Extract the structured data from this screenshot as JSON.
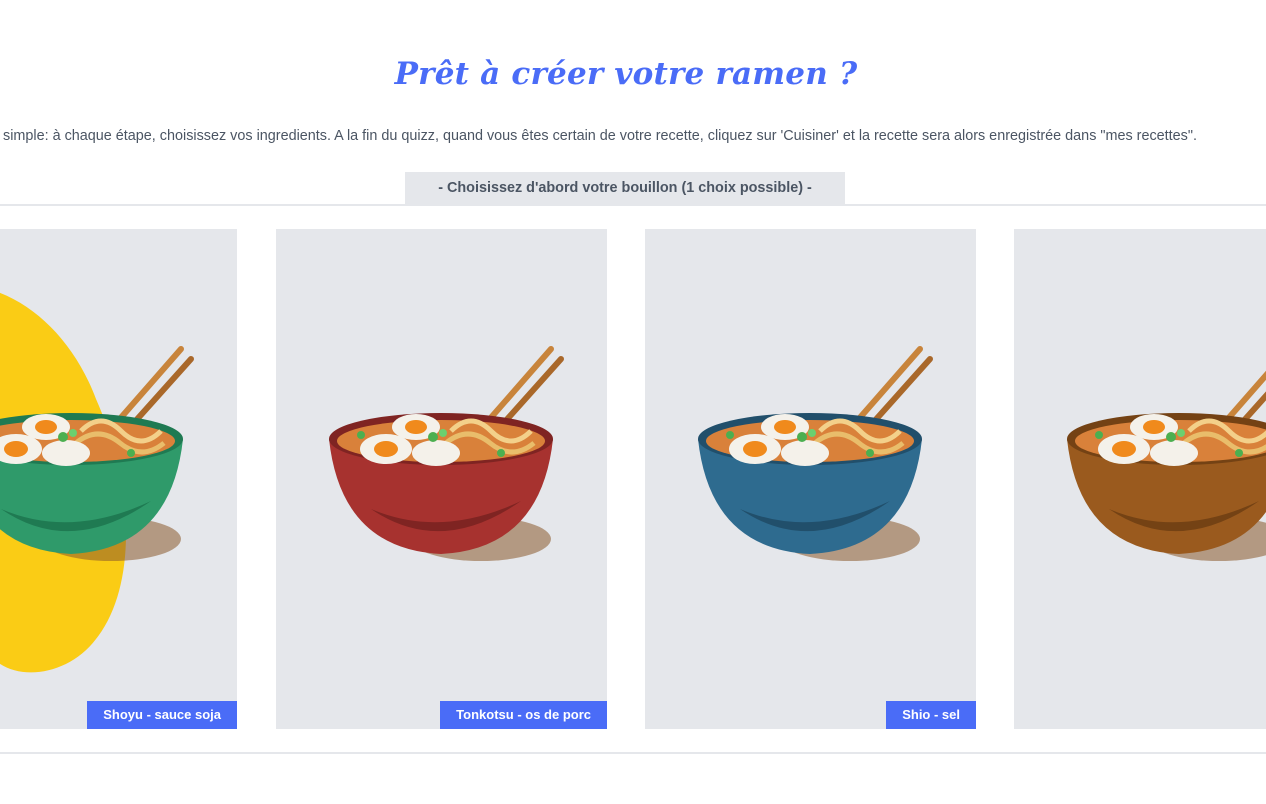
{
  "header": {
    "title": "Prêt à créer votre ramen ?",
    "intro": "simple: à chaque étape, choisissez vos ingredients. A la fin du quizz, quand vous êtes certain de votre recette, cliquez sur 'Cuisiner' et la recette sera alors enregistrée dans \"mes recettes\"."
  },
  "step": {
    "label": "- Choisissez d'abord votre bouillon (1 choix possible) -"
  },
  "colors": {
    "accent": "#4a6cf7",
    "card_bg": "#e5e7eb",
    "selected_blob": "#facc15"
  },
  "options": [
    {
      "label": "Shoyu - sauce soja",
      "bowl_color": "#2f9a6a",
      "bowl_shade": "#1f7a52",
      "selected": true,
      "icon": "ramen-bowl-icon"
    },
    {
      "label": "Tonkotsu - os de porc",
      "bowl_color": "#a7322f",
      "bowl_shade": "#7f2422",
      "selected": false,
      "icon": "ramen-bowl-icon"
    },
    {
      "label": "Shio - sel",
      "bowl_color": "#2e6b8f",
      "bowl_shade": "#214f6b",
      "selected": false,
      "icon": "ramen-bowl-icon"
    },
    {
      "label": "",
      "bowl_color": "#9a5a1e",
      "bowl_shade": "#744214",
      "selected": false,
      "icon": "ramen-bowl-icon"
    }
  ]
}
